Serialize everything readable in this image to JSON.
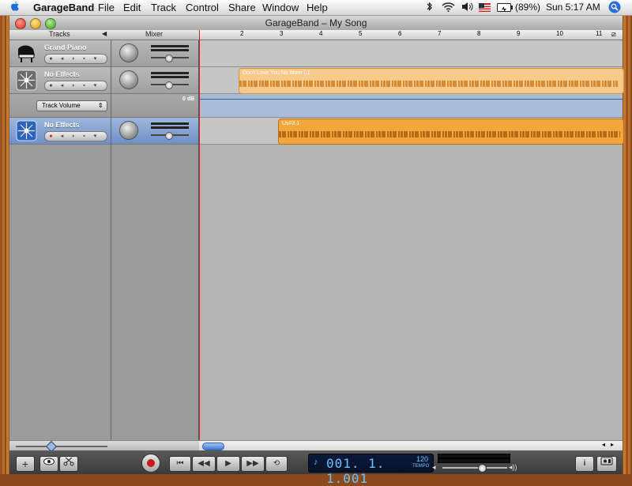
{
  "menubar": {
    "app_name": "GarageBand",
    "items": [
      "File",
      "Edit",
      "Track",
      "Control",
      "Share",
      "Window",
      "Help"
    ],
    "battery": "(89%)",
    "clock": "Sun 5:17 AM"
  },
  "window": {
    "title": "GarageBand – My Song"
  },
  "header": {
    "tracks_label": "Tracks",
    "mixer_label": "Mixer"
  },
  "ruler": {
    "marks": [
      "2",
      "3",
      "4",
      "5",
      "6",
      "7",
      "8",
      "9",
      "10",
      "11"
    ]
  },
  "tracks": [
    {
      "name": "Grand Piano",
      "icon": "piano-icon"
    },
    {
      "name": "No Effects",
      "icon": "starburst-icon"
    },
    {
      "name": "No Effects",
      "icon": "starburst-icon",
      "selected": true
    }
  ],
  "automation": {
    "label": "Track Volume",
    "db_label": "0 dB"
  },
  "regions": [
    {
      "name": "Don't Love You No More (.1",
      "color": "#f7c98a"
    },
    {
      "name": "Us#3.1",
      "color": "#f2a73c"
    }
  ],
  "lcd": {
    "position": "001. 1. 1.001",
    "tempo_value": "120",
    "tempo_label": "TEMPO"
  },
  "colors": {
    "accent_blue": "#6f8fc5",
    "playhead": "#e02020",
    "region_light": "#f7c98a",
    "region_dark": "#f2a73c"
  }
}
